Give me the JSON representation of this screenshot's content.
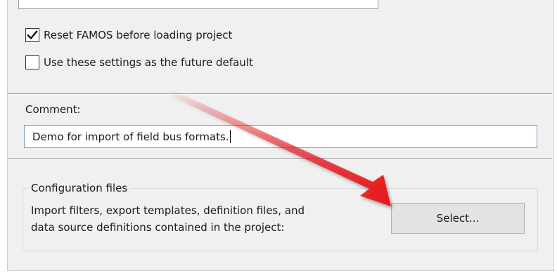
{
  "options": {
    "reset_famos": {
      "label": "Reset FAMOS before loading project",
      "checked": true
    },
    "future_default": {
      "label": "Use these settings as the future default",
      "checked": false
    }
  },
  "comment": {
    "label": "Comment:",
    "value": "Demo for import of field bus formats."
  },
  "config_files": {
    "title": "Configuration files",
    "description_line1": "Import filters, export templates, definition files, and",
    "description_line2": "data source definitions contained in the project:",
    "select_label": "Select..."
  },
  "annotation": {
    "arrow_color": "#e8141a",
    "arrow_icon": "red-arrow-icon"
  },
  "colors": {
    "panel_background": "#f0f0f0",
    "input_focus_border": "#7a9cc6"
  }
}
